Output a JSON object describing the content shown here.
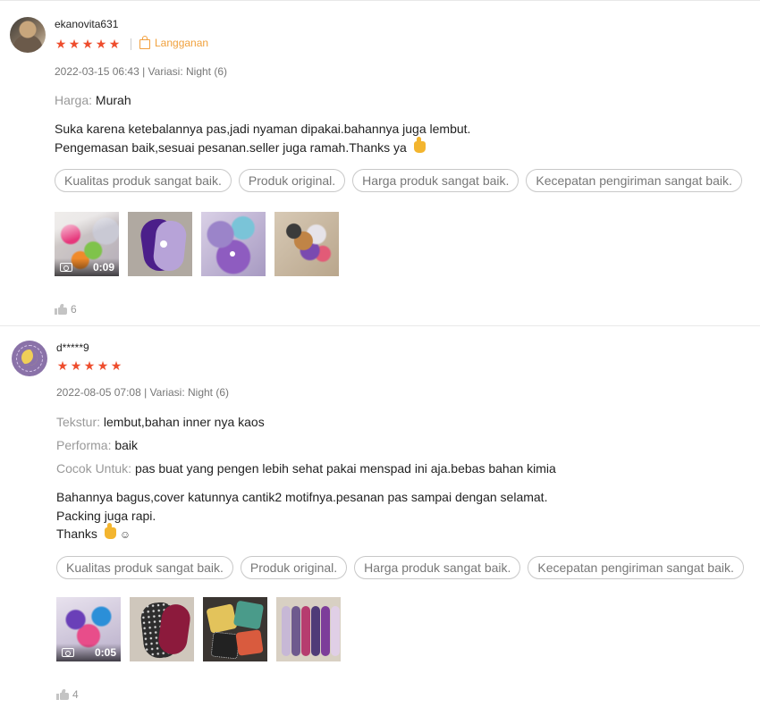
{
  "reviews": [
    {
      "username": "ekanovita631",
      "rating": 5,
      "subscription_label": "Langganan",
      "meta": "2022-03-15 06:43 | Variasi: Night (6)",
      "attributes": [
        {
          "key": "Harga:",
          "value": "Murah"
        }
      ],
      "comment_lines": [
        "Suka karena ketebalannya pas,jadi nyaman dipakai.bahannya juga lembut.",
        "Pengemasan baik,sesuai pesanan.seller juga ramah.Thanks ya"
      ],
      "tags": [
        "Kualitas produk sangat baik.",
        "Produk original.",
        "Harga produk sangat baik.",
        "Kecepatan pengiriman sangat baik."
      ],
      "media": [
        {
          "type": "video",
          "icon": "camera-icon",
          "duration": "0:09"
        },
        {
          "type": "image"
        },
        {
          "type": "image"
        },
        {
          "type": "image"
        }
      ],
      "likes": "6"
    },
    {
      "username": "d*****9",
      "rating": 5,
      "meta": "2022-08-05 07:08 | Variasi: Night (6)",
      "attributes": [
        {
          "key": "Tekstur:",
          "value": "lembut,bahan inner nya kaos"
        },
        {
          "key": "Performa:",
          "value": "baik"
        },
        {
          "key": "Cocok Untuk:",
          "value": "pas buat yang pengen lebih sehat pakai menspad ini aja.bebas bahan kimia"
        }
      ],
      "comment_lines": [
        "Bahannya bagus,cover katunnya cantik2 motifnya.pesanan pas sampai dengan selamat.",
        "Packing juga rapi.",
        "Thanks"
      ],
      "tags": [
        "Kualitas produk sangat baik.",
        "Produk original.",
        "Harga produk sangat baik.",
        "Kecepatan pengiriman sangat baik."
      ],
      "media": [
        {
          "type": "video",
          "icon": "camera-icon",
          "duration": "0:05"
        },
        {
          "type": "image"
        },
        {
          "type": "image"
        },
        {
          "type": "image"
        }
      ],
      "likes": "4"
    }
  ],
  "colors": {
    "star": "#ee4d2d",
    "subscription": "#f0a13d"
  }
}
